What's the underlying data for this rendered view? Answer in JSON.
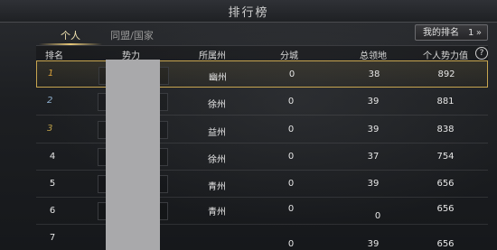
{
  "window": {
    "title": "排行榜"
  },
  "tabs": [
    {
      "label": "个人",
      "active": true
    },
    {
      "label": "同盟/国家",
      "active": false
    }
  ],
  "my_rank": {
    "label": "我的排名",
    "value": "1",
    "arrow": "»"
  },
  "columns": {
    "rank": "排名",
    "faction": "势力",
    "state": "所属州",
    "branch": "分城",
    "territory": "总领地",
    "power": "个人势力值",
    "help": "?"
  },
  "rows": [
    {
      "rank": "1",
      "state": "幽州",
      "branch": "0",
      "territory": "38",
      "power": "892"
    },
    {
      "rank": "2",
      "state": "徐州",
      "branch": "0",
      "territory": "39",
      "power": "881"
    },
    {
      "rank": "3",
      "state": "益州",
      "branch": "0",
      "territory": "39",
      "power": "838"
    },
    {
      "rank": "4",
      "state": "徐州",
      "branch": "0",
      "territory": "37",
      "power": "754"
    },
    {
      "rank": "5",
      "state": "青州",
      "branch": "0",
      "territory": "39",
      "power": "656"
    },
    {
      "rank": "6",
      "state": "青州",
      "branch": "0",
      "territory": "0",
      "power": "656"
    },
    {
      "rank": "7",
      "state": "",
      "branch": "0",
      "territory": "39",
      "power": "656"
    }
  ],
  "colors": {
    "highlight_border": "#c7a550",
    "medal_gold": "#d9a03a",
    "medal_silver": "#8fb0cf",
    "medal_bronze": "#c0a24a"
  }
}
